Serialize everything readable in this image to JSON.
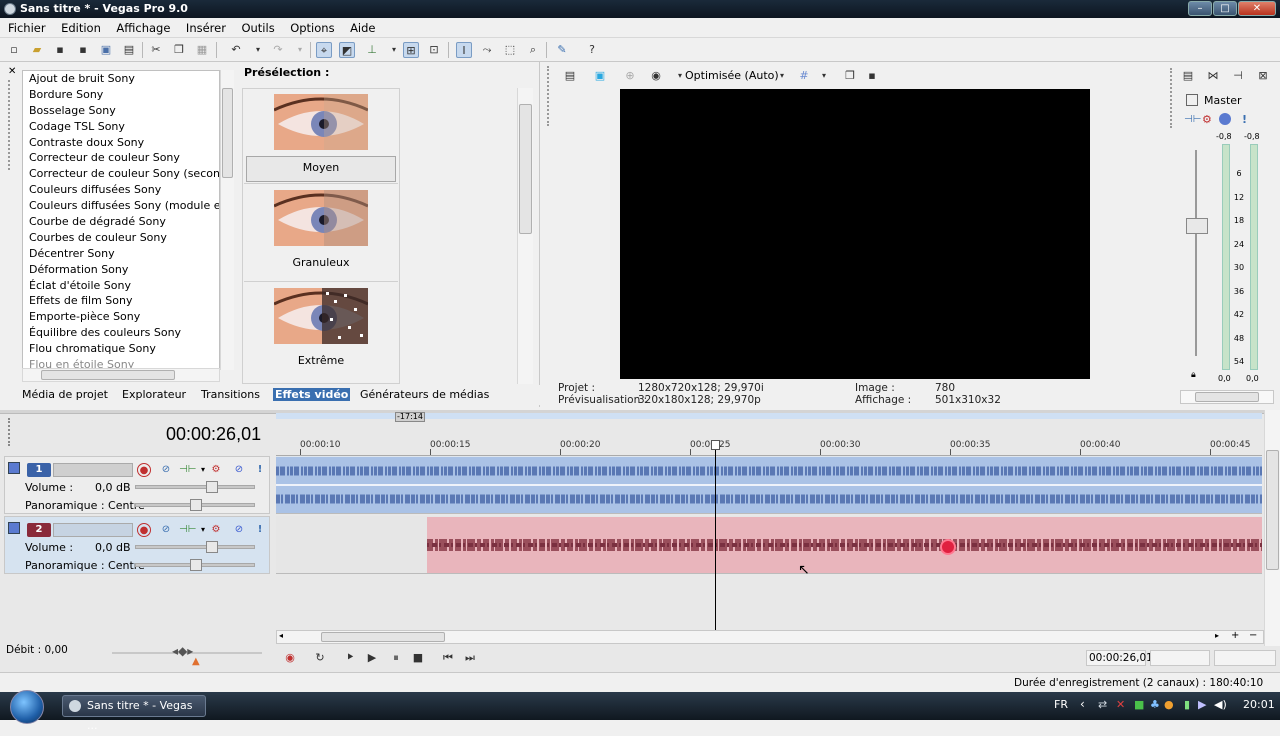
{
  "window": {
    "title": "Sans titre * - Vegas Pro 9.0",
    "min": "–",
    "max": "□",
    "close": "✕"
  },
  "menu": [
    "Fichier",
    "Edition",
    "Affichage",
    "Insérer",
    "Outils",
    "Options",
    "Aide"
  ],
  "fx_list": [
    "Ajout de bruit Sony",
    "Bordure Sony",
    "Bosselage Sony",
    "Codage TSL Sony",
    "Contraste doux Sony",
    "Correcteur de couleur Sony",
    "Correcteur de couleur Sony (secondaire)",
    "Couleurs diffusées Sony",
    "Couleurs diffusées Sony (module externe",
    "Courbe de dégradé Sony",
    "Courbes de couleur Sony",
    "Décentrer Sony",
    "Déformation Sony",
    "Éclat d'étoile Sony",
    "Effets de film Sony",
    "Emporte-pièce Sony",
    "Équilibre des couleurs Sony",
    "Flou chromatique Sony",
    "Flou en étoile Sony"
  ],
  "presets": {
    "title": "Présélection :",
    "items": [
      "Moyen",
      "Granuleux",
      "Extrême"
    ]
  },
  "tabs": [
    "Média de projet",
    "Explorateur",
    "Transitions",
    "Effets vidéo",
    "Générateurs de médias"
  ],
  "preview": {
    "quality": "Optimisée (Auto)",
    "projet_label": "Projet :",
    "projet_value": "1280x720x128; 29,970i",
    "previsu_label": "Prévisualisation :",
    "previsu_value": "320x180x128; 29,970p",
    "image_label": "Image :",
    "image_value": "780",
    "affichage_label": "Affichage :",
    "affichage_value": "501x310x32"
  },
  "mixer": {
    "master": "Master",
    "peak_left": "-0,8",
    "peak_right": "-0,8",
    "scale": [
      "6",
      "12",
      "18",
      "24",
      "30",
      "36",
      "42",
      "48",
      "54"
    ],
    "bottom_left": "0,0",
    "bottom_right": "0,0"
  },
  "timeline": {
    "time": "00:00:26,01",
    "marker": "-17:14",
    "ticks": [
      "00:00:10",
      "00:00:15",
      "00:00:20",
      "00:00:25",
      "00:00:30",
      "00:00:35",
      "00:00:40",
      "00:00:45"
    ],
    "tracks": [
      {
        "num": "1",
        "volume_label": "Volume :",
        "volume_value": "0,0 dB",
        "pan_label": "Panoramique :",
        "pan_value": "Centre"
      },
      {
        "num": "2",
        "volume_label": "Volume :",
        "volume_value": "0,0 dB",
        "pan_label": "Panoramique :",
        "pan_value": "Centre"
      }
    ],
    "rate": "Débit : 0,00",
    "position": "00:00:26,01"
  },
  "status": {
    "text": "Durée d'enregistrement (2 canaux) : 180:40:10"
  },
  "taskbar": {
    "item": "Sans titre * - Vegas ...",
    "lang": "FR",
    "clock": "20:01"
  },
  "colors": {
    "accent": "#3a6fb0",
    "track1": "#3a62a8",
    "track2": "#8a2a3a",
    "audio_clip": "#aac2e6",
    "video_clip": "#e9b5bc"
  }
}
